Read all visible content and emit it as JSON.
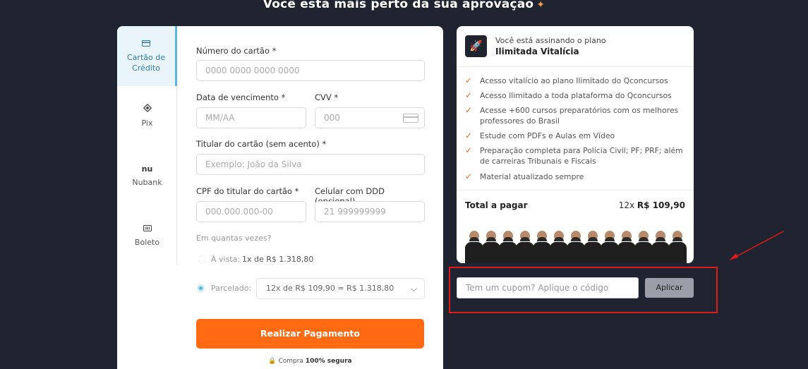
{
  "page": {
    "title": "Você está mais perto da sua aprovação",
    "title_icon": "sparkle-icon"
  },
  "methods": [
    {
      "label": "Cartão de Crédito",
      "icon": "credit-card-icon",
      "active": true
    },
    {
      "label": "Pix",
      "icon": "pix-icon",
      "active": false
    },
    {
      "label": "Nubank",
      "icon": "nubank-icon",
      "active": false
    },
    {
      "label": "Boleto",
      "icon": "barcode-icon",
      "active": false
    }
  ],
  "form": {
    "card_number_label": "Número do cartão *",
    "card_number_placeholder": "0000 0000 0000 0000",
    "expiry_label": "Data de vencimento *",
    "expiry_placeholder": "MM/AA",
    "cvv_label": "CVV *",
    "cvv_placeholder": "000",
    "holder_label": "Titular do cartão (sem acento) *",
    "holder_placeholder": "Exemplo: João da Silva",
    "cpf_label": "CPF do titular do cartão *",
    "cpf_placeholder": "000.000.000-00",
    "phone_label": "Celular com DDD (opcional)",
    "phone_placeholder": "21 999999999",
    "installments_question": "Em quantas vezes?",
    "cash_label": "À vista:",
    "cash_value": "1x de R$ 1.318,80",
    "installment_label": "Parcelado:",
    "installment_selected": "12x de R$ 109,90 = R$ 1.318,80",
    "submit_label": "Realizar Pagamento",
    "secure_prefix": "Compra",
    "secure_bold": "100% segura"
  },
  "plan": {
    "subscribing_text": "Você está assinando o plano",
    "plan_name": "Ilimitada Vitalícia",
    "features": [
      "Acesso vitalício ao plano Ilimitado do Qconcursos",
      "Acesso Ilimitado a toda plataforma do Qconcursos",
      "Acesse +600 cursos preparatórios com os melhores professores do Brasil",
      "Estude com PDFs e Aulas em Vídeo",
      "Preparação completa para Polícia Civil; PF; PRF; além de carreiras Tribunais e Fiscais",
      "Material atualizado sempre"
    ],
    "total_label": "Total a pagar",
    "total_prefix": "12x",
    "total_value": "R$ 109,90"
  },
  "coupon": {
    "placeholder": "Tem um cupom? Aplique o código",
    "apply_label": "Aplicar"
  },
  "colors": {
    "accent": "#ff6a13",
    "highlight": "#e01b1b",
    "active_tab": "#e9f5fb"
  }
}
